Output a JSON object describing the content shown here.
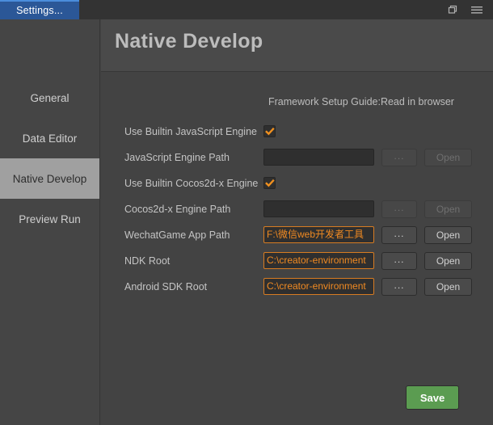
{
  "titlebar": {
    "tab_label": "Settings...",
    "restore_icon": "restore-window-icon",
    "menu_icon": "hamburger-menu-icon"
  },
  "header": {
    "title": "Native Develop"
  },
  "sidebar": {
    "items": [
      {
        "label": "General",
        "active": false
      },
      {
        "label": "Data Editor",
        "active": false
      },
      {
        "label": "Native Develop",
        "active": true
      },
      {
        "label": "Preview Run",
        "active": false
      }
    ]
  },
  "main": {
    "guide_text": "Framework Setup Guide:Read in browser",
    "rows": [
      {
        "type": "checkbox",
        "label": "Use Builtin JavaScript Engine",
        "checked": true
      },
      {
        "type": "path",
        "label": "JavaScript Engine Path",
        "value": "",
        "dots_label": "...",
        "open_label": "Open",
        "disabled": true
      },
      {
        "type": "checkbox",
        "label": "Use Builtin Cocos2d-x Engine",
        "checked": true
      },
      {
        "type": "path",
        "label": "Cocos2d-x Engine Path",
        "value": "",
        "dots_label": "...",
        "open_label": "Open",
        "disabled": true
      },
      {
        "type": "path",
        "label": "WechatGame App Path",
        "value": "F:\\微信web开发者工具",
        "dots_label": "...",
        "open_label": "Open",
        "disabled": false
      },
      {
        "type": "path",
        "label": "NDK Root",
        "value": "C:\\creator-environment",
        "dots_label": "...",
        "open_label": "Open",
        "disabled": false
      },
      {
        "type": "path",
        "label": "Android SDK Root",
        "value": "C:\\creator-environment",
        "dots_label": "...",
        "open_label": "Open",
        "disabled": false
      }
    ],
    "save_label": "Save"
  },
  "colors": {
    "tab_accent": "#2b5797",
    "checkbox_check": "#f0901f",
    "field_text": "#f08a22",
    "save_green": "#5b9c51",
    "sidebar_active": "#a0a0a0"
  }
}
